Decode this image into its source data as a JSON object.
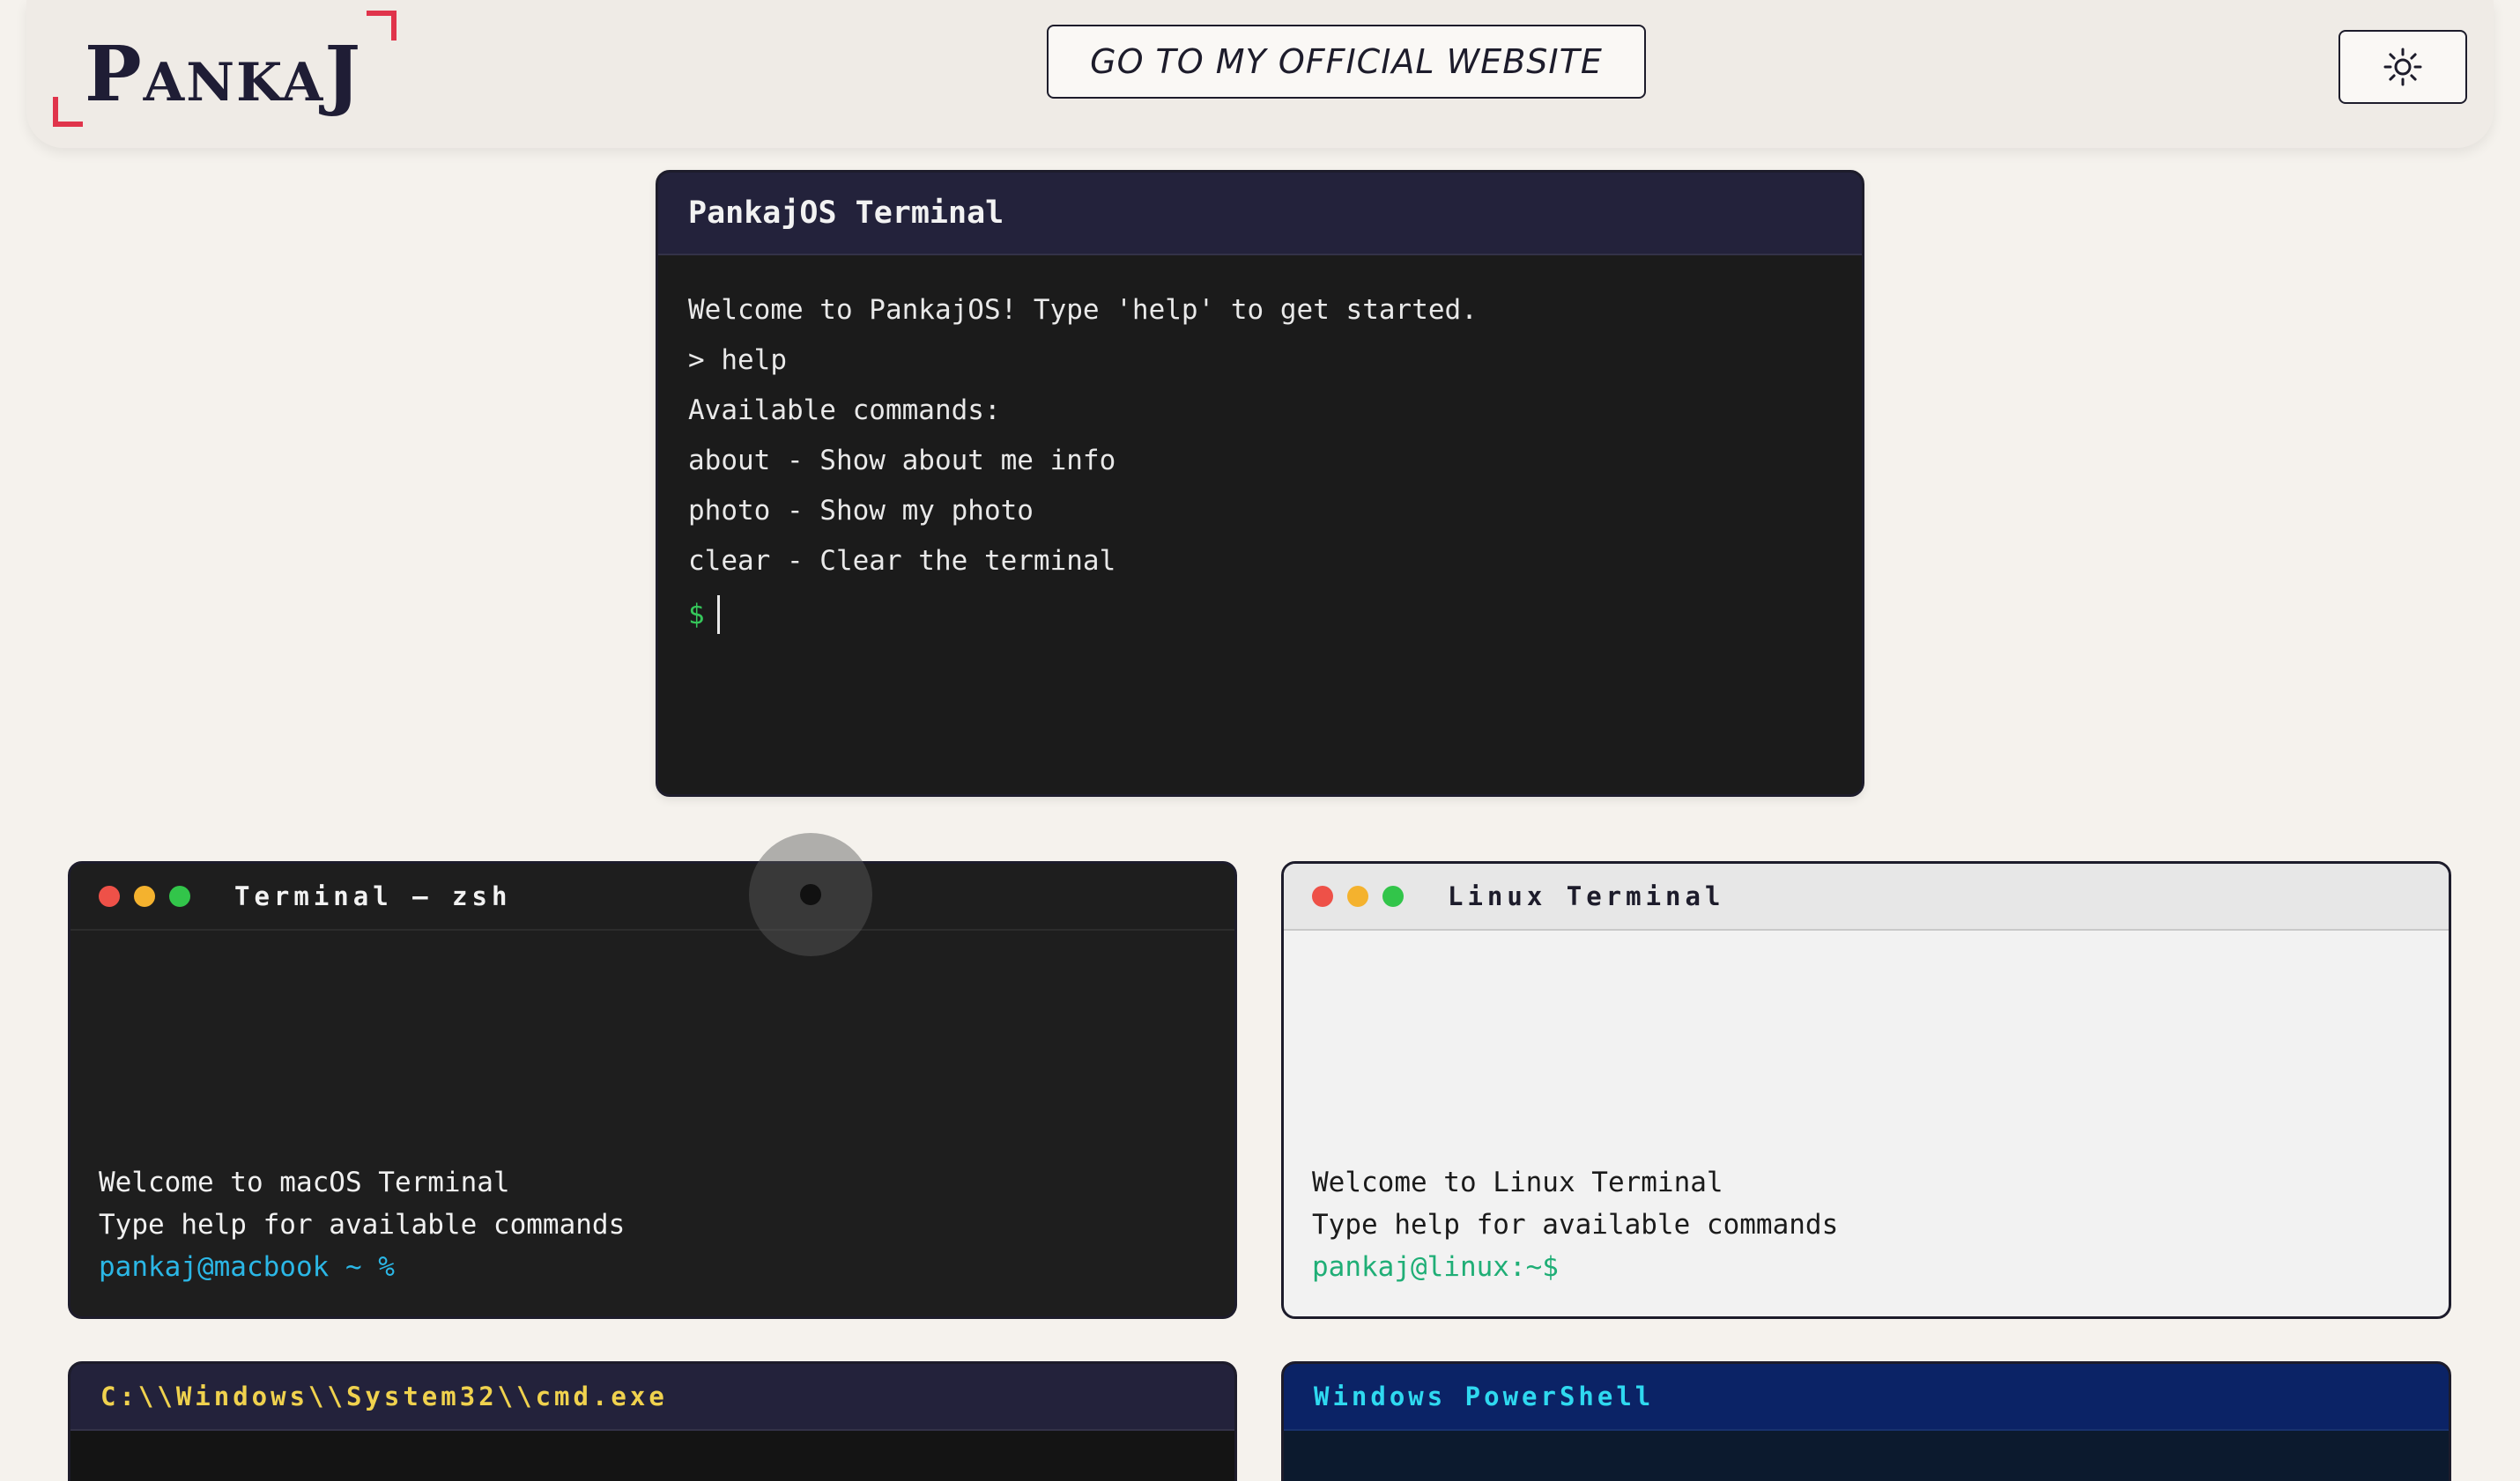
{
  "header": {
    "logo_text": "PANKAJ",
    "website_button": "GO TO MY OFFICIAL WEBSITE",
    "theme_toggle_icon": "sun-icon"
  },
  "main_terminal": {
    "title": "PankajOS Terminal",
    "lines": [
      "Welcome to PankajOS! Type 'help' to get started.",
      "> help",
      "Available commands:",
      "about - Show about me info",
      "photo - Show my photo",
      "clear - Clear the terminal"
    ],
    "prompt": "$"
  },
  "mac_terminal": {
    "title": "Terminal — zsh",
    "line1": "Welcome to macOS Terminal",
    "line2": "Type help for available commands",
    "prompt": "pankaj@macbook ~ %"
  },
  "linux_terminal": {
    "title": "Linux Terminal",
    "line1": "Welcome to Linux Terminal",
    "line2": "Type help for available commands",
    "prompt": "pankaj@linux:~$"
  },
  "cmd_terminal": {
    "title": "C:\\\\Windows\\\\System32\\\\cmd.exe"
  },
  "powershell_terminal": {
    "title": "Windows PowerShell"
  },
  "colors": {
    "background": "#f5f2ed",
    "accent_red": "#e0344b",
    "navy": "#1d1c2b",
    "prompt_green": "#35c75a",
    "mac_prompt": "#2bb7e6",
    "linux_prompt": "#1fae76",
    "cmd_title": "#f0d24e",
    "powershell_title": "#2fd9f0"
  }
}
